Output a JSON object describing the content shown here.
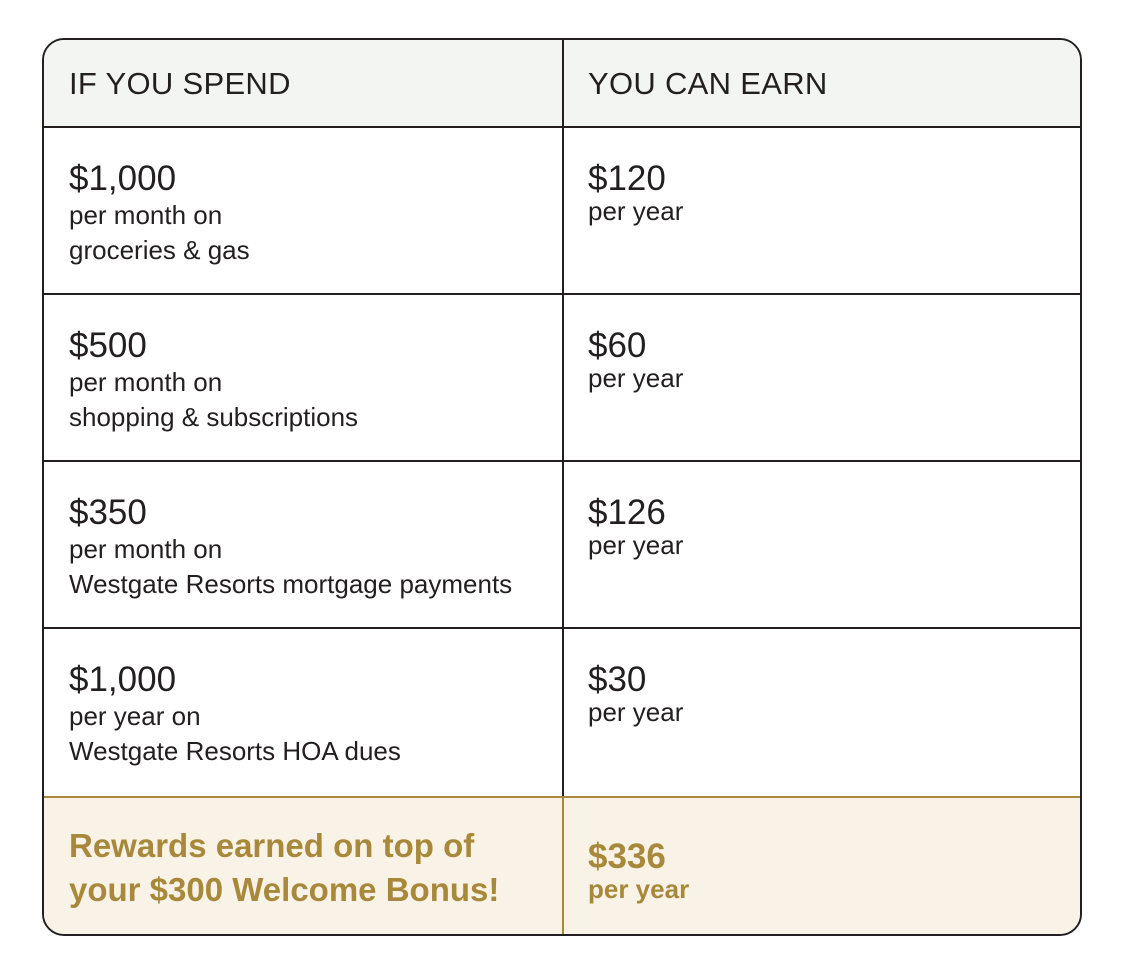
{
  "header": {
    "spend_label": "IF YOU SPEND",
    "earn_label": "YOU CAN EARN"
  },
  "rows": [
    {
      "spend_amount": "$1,000",
      "spend_line1": "per month on",
      "spend_line2": "groceries & gas",
      "earn_amount": "$120",
      "earn_unit": "per year"
    },
    {
      "spend_amount": "$500",
      "spend_line1": "per month on",
      "spend_line2": "shopping & subscriptions",
      "earn_amount": "$60",
      "earn_unit": "per year"
    },
    {
      "spend_amount": "$350",
      "spend_line1": "per month on",
      "spend_line2": "Westgate Resorts mortgage payments",
      "earn_amount": "$126",
      "earn_unit": "per year"
    },
    {
      "spend_amount": "$1,000",
      "spend_line1": "per year on",
      "spend_line2": "Westgate Resorts HOA dues",
      "earn_amount": "$30",
      "earn_unit": "per year"
    }
  ],
  "footer": {
    "line1": "Rewards earned on top of",
    "line2": "your $300 Welcome Bonus!",
    "total_amount": "$336",
    "total_unit": "per year"
  },
  "colors": {
    "border": "#231f20",
    "header_bg": "#f3f5f3",
    "gold": "#a8893b",
    "footer_bg": "#f9f2e6"
  }
}
